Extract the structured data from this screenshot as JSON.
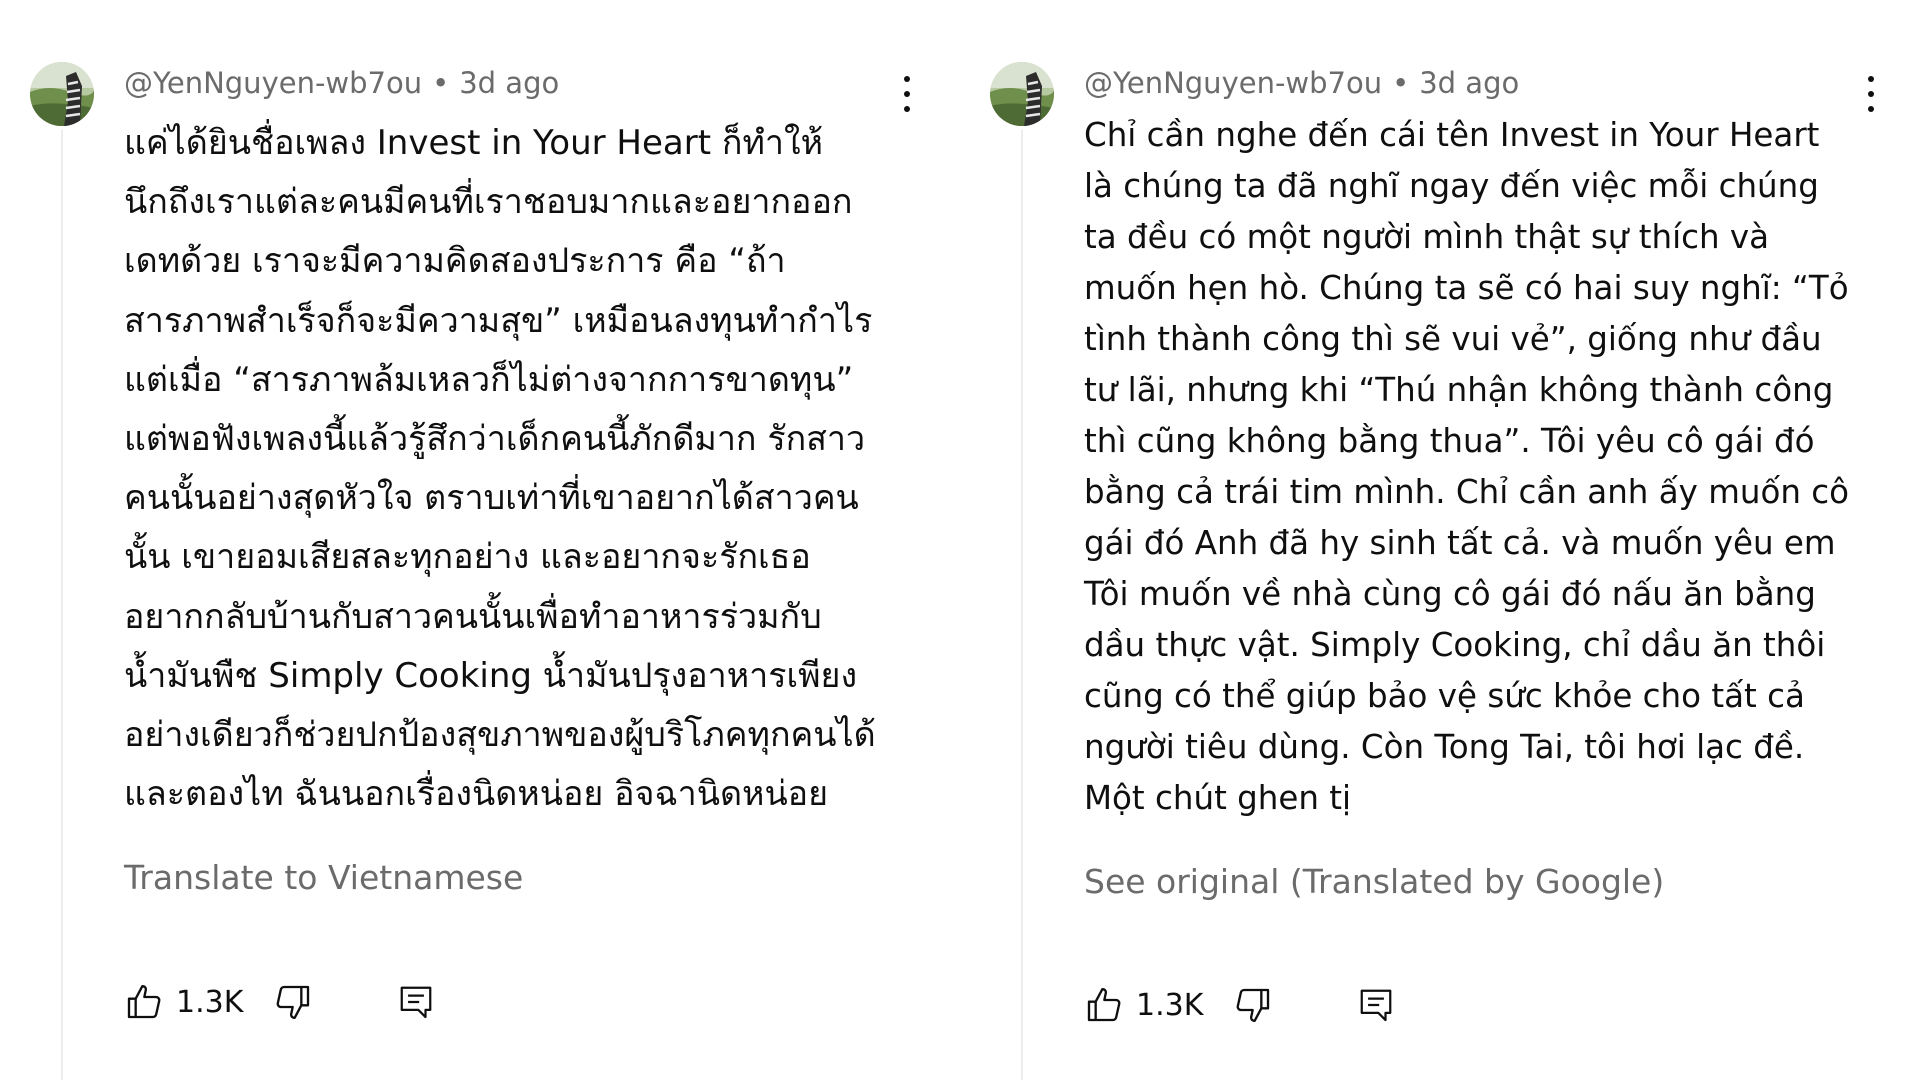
{
  "comments": [
    {
      "author": "@YenNguyen-wb7ou",
      "separator": "•",
      "time": "3d ago",
      "lines": [
        "แค่ได้ยินชื่อเพลง Invest in Your Heart ก็ทำให้",
        "นึกถึงเราแต่ละคนมีคนที่เราชอบมากและอยากออก",
        "เดทด้วย เราจะมีความคิดสองประการ คือ “ถ้า",
        "สารภาพสำเร็จก็จะมีความสุข” เหมือนลงทุนทำกำไร",
        "แต่เมื่อ “สารภาพล้มเหลวก็ไม่ต่างจากการขาดทุน”",
        "แต่พอฟังเพลงนี้แล้วรู้สึกว่าเด็กคนนี้ภักดีมาก รักสาว",
        "คนนั้นอย่างสุดหัวใจ ตราบเท่าที่เขาอยากได้สาวคน",
        "นั้น เขายอมเสียสละทุกอย่าง และอยากจะรักเธอ",
        "อยากกลับบ้านกับสาวคนนั้นเพื่อทำอาหารร่วมกับ",
        "น้ำมันพืช Simply Cooking น้ำมันปรุงอาหารเพียง",
        "อย่างเดียวก็ช่วยปกป้องสุขภาพของผู้บริโภคทุกคนได้",
        "และตองไท ฉันนอกเรื่องนิดหน่อย อิจฉานิดหน่อย"
      ],
      "translate_label": "Translate to Vietnamese",
      "likes": "1.3K"
    },
    {
      "author": "@YenNguyen-wb7ou",
      "separator": "•",
      "time": "3d ago",
      "lines": [
        "Chỉ cần nghe đến cái tên Invest in Your Heart",
        "là chúng ta đã nghĩ ngay đến việc mỗi chúng",
        "ta đều có một người mình thật sự thích và",
        "muốn hẹn hò. Chúng ta sẽ có hai suy nghĩ: “Tỏ",
        "tình thành công thì sẽ vui vẻ”, giống như đầu",
        "tư lãi, nhưng khi “Thú nhận không thành công",
        "thì cũng không bằng thua”. Tôi yêu cô gái đó",
        "bằng cả trái tim mình. Chỉ cần anh ấy muốn cô",
        "gái đó Anh đã hy sinh tất cả. và muốn yêu em",
        "Tôi muốn về nhà cùng cô gái đó nấu ăn bằng",
        "dầu thực vật. Simply Cooking, chỉ dầu ăn thôi",
        "cũng có thể giúp bảo vệ sức khỏe cho tất cả",
        "người tiêu dùng. Còn Tong Tai, tôi hơi lạc đề.",
        "Một chút ghen tị"
      ],
      "translate_label": "See original (Translated by Google)",
      "likes": "1.3K"
    }
  ],
  "icons": {
    "avatar": "avatar",
    "more": "more-vert-icon",
    "like": "thumbs-up-icon",
    "dislike": "thumbs-down-icon",
    "reply": "comment-reply-icon"
  }
}
